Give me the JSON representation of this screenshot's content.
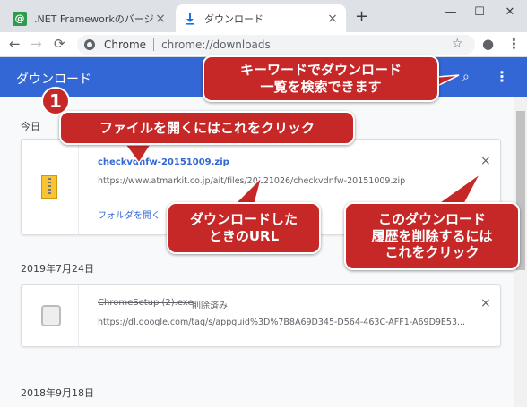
{
  "tabs": [
    {
      "favicon": "@",
      "title": ".NET Frameworkのバージョンを確認",
      "close": "×"
    },
    {
      "title": "ダウンロード",
      "close": "×"
    }
  ],
  "newtab": "+",
  "window": {
    "minimize": "—",
    "maximize": "☐",
    "close": "✕"
  },
  "toolbar": {
    "back": "←",
    "forward": "→",
    "reload": "⟳",
    "star": "☆",
    "profile": "●",
    "menu": "⋮"
  },
  "omnibox": {
    "site": "Chrome",
    "url": "chrome://downloads"
  },
  "header": {
    "title": "ダウンロード",
    "search": "⌕",
    "menu": "⋮"
  },
  "groups": [
    {
      "date": "今日",
      "item": {
        "filename": "checkvdnfw-20151009.zip",
        "url": "https://www.atmarkit.co.jp/ait/files/20121026/checkvdnfw-20151009.zip",
        "action": "フォルダを開く",
        "close": "×"
      }
    },
    {
      "date": "2019年7月24日",
      "item": {
        "filename": "ChromeSetup (2).exe",
        "status": "削除済み",
        "url": "https://dl.google.com/tag/s/appguid%3D%7B8A69D345-D564-463C-AFF1-A69D9E53...",
        "close": "×"
      }
    },
    {
      "date": "2018年9月18日"
    }
  ],
  "callouts": {
    "badge": "1",
    "open_file": "ファイルを開くにはこれをクリック",
    "search": "キーワードでダウンロード\n一覧を検索できます",
    "url": "ダウンロードした\nときのURL",
    "delete": "このダウンロード\n履歴を削除するには\nこれをクリック"
  },
  "colors": {
    "header": "#3367d6",
    "callout": "#c62828",
    "tabstrip": "#dee1e6"
  }
}
